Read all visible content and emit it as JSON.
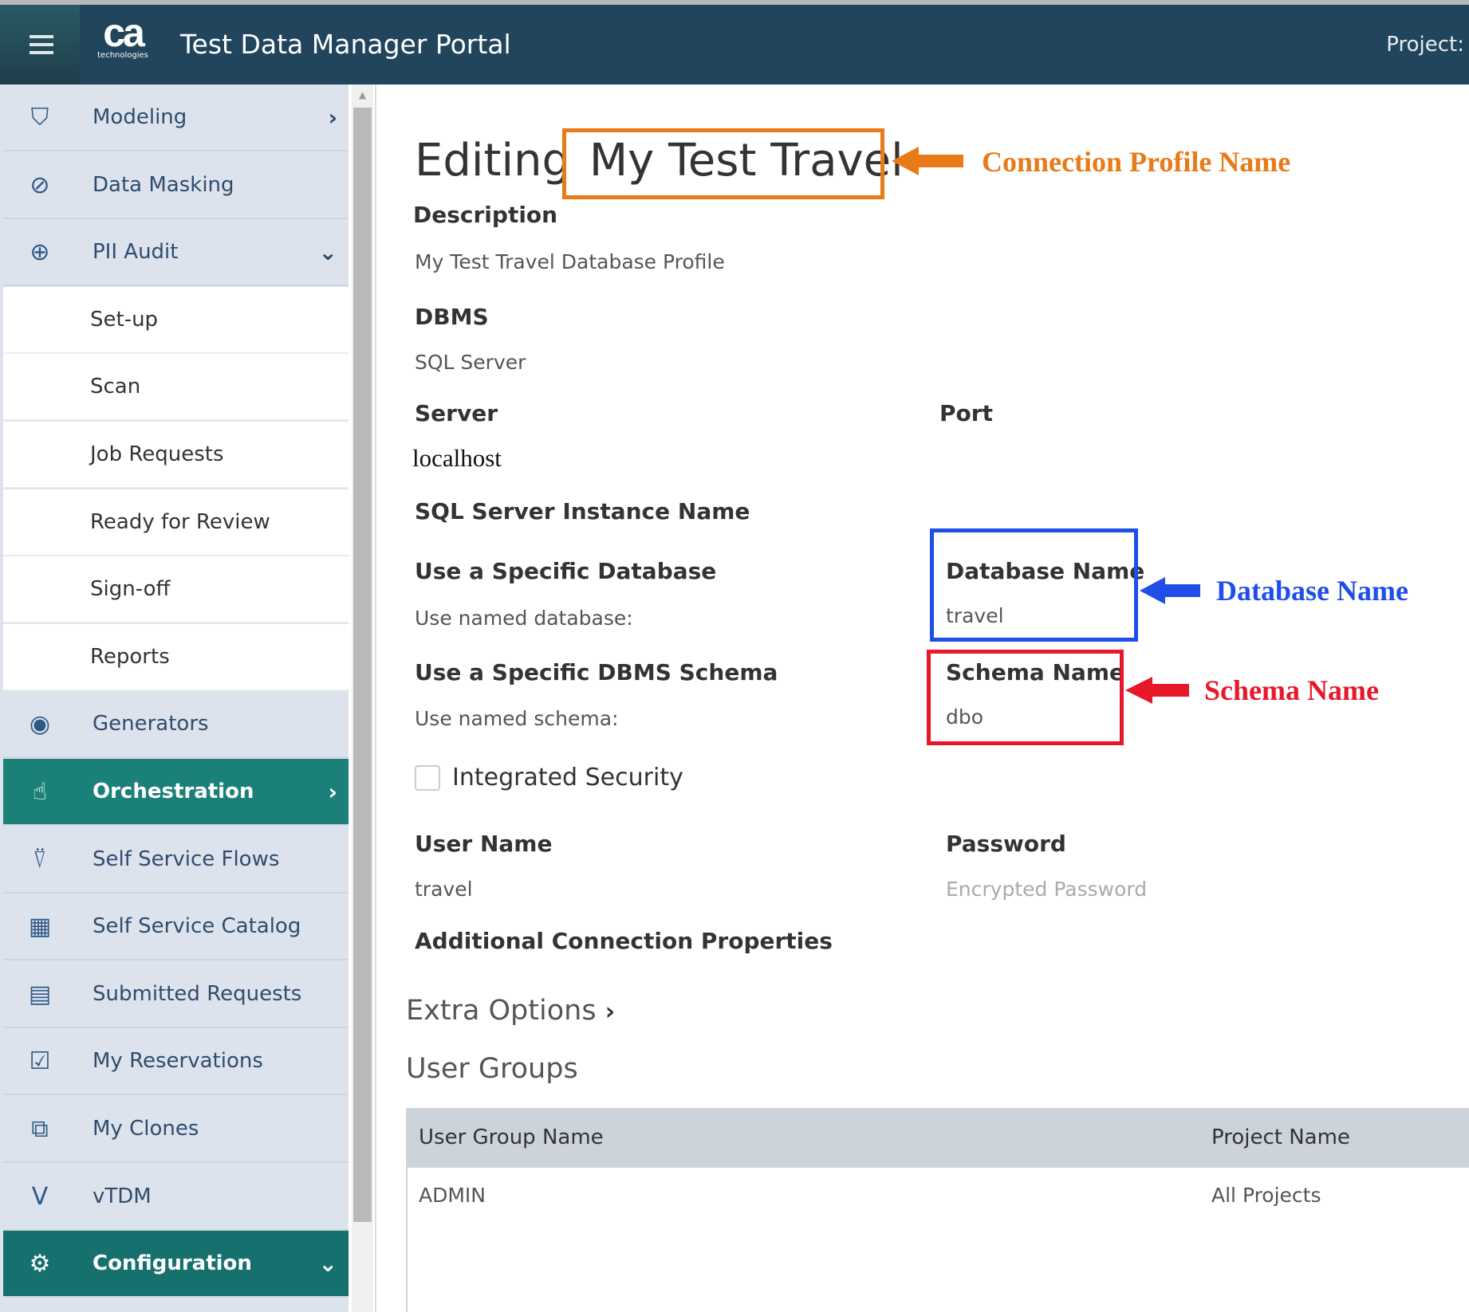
{
  "header": {
    "title": "Test Data Manager Portal",
    "logo_text": "ca",
    "logo_sub": "technologies",
    "project_label": "Project:"
  },
  "sidebar": {
    "items": [
      {
        "label": "Modeling",
        "icon": "modeling-icon",
        "chevron": "›"
      },
      {
        "label": "Data Masking",
        "icon": "data-masking-icon"
      },
      {
        "label": "PII Audit",
        "icon": "pii-audit-icon",
        "chevron": "⌄"
      },
      {
        "label": "Set-up"
      },
      {
        "label": "Scan"
      },
      {
        "label": "Job Requests"
      },
      {
        "label": "Ready for Review"
      },
      {
        "label": "Sign-off"
      },
      {
        "label": "Reports"
      },
      {
        "label": "Generators",
        "icon": "generators-icon"
      },
      {
        "label": "Orchestration",
        "icon": "orchestration-icon",
        "chevron": "›"
      },
      {
        "label": "Self Service Flows",
        "icon": "self-service-flows-icon"
      },
      {
        "label": "Self Service Catalog",
        "icon": "grid-icon"
      },
      {
        "label": "Submitted Requests",
        "icon": "submitted-requests-icon"
      },
      {
        "label": "My Reservations",
        "icon": "calendar-check-icon"
      },
      {
        "label": "My Clones",
        "icon": "clones-icon"
      },
      {
        "label": "vTDM",
        "icon": "vtdm-icon"
      },
      {
        "label": "Configuration",
        "icon": "gear-icon",
        "chevron": "⌄"
      }
    ]
  },
  "main": {
    "editing_label": "Editing",
    "profile_name": "My Test Travel",
    "description_label": "Description",
    "description_value": "My Test Travel Database Profile",
    "dbms_label": "DBMS",
    "dbms_value": "SQL Server",
    "server_label": "Server",
    "server_value": "localhost",
    "port_label": "Port",
    "instance_label": "SQL Server Instance Name",
    "specific_db_label": "Use a Specific Database",
    "specific_db_value": "Use named database:",
    "db_name_label": "Database Name",
    "db_name_value": "travel",
    "specific_schema_label": "Use a Specific DBMS Schema",
    "specific_schema_value": "Use named schema:",
    "schema_name_label": "Schema Name",
    "schema_name_value": "dbo",
    "integrated_security_label": "Integrated Security",
    "integrated_security_checked": false,
    "username_label": "User Name",
    "username_value": "travel",
    "password_label": "Password",
    "password_placeholder": "Encrypted Password",
    "additional_props_label": "Additional Connection Properties",
    "extra_options_label": "Extra Options",
    "extra_options_chevron": "›",
    "user_groups_label": "User Groups",
    "table": {
      "headers": [
        "User Group Name",
        "Project Name"
      ],
      "rows": [
        [
          "ADMIN",
          "All Projects"
        ]
      ]
    }
  },
  "annotations": {
    "profile": {
      "text": "Connection Profile Name",
      "color": "#e87b17"
    },
    "database": {
      "text": "Database Name",
      "color": "#1f4ee8"
    },
    "schema": {
      "text": "Schema Name",
      "color": "#e8182b"
    }
  }
}
